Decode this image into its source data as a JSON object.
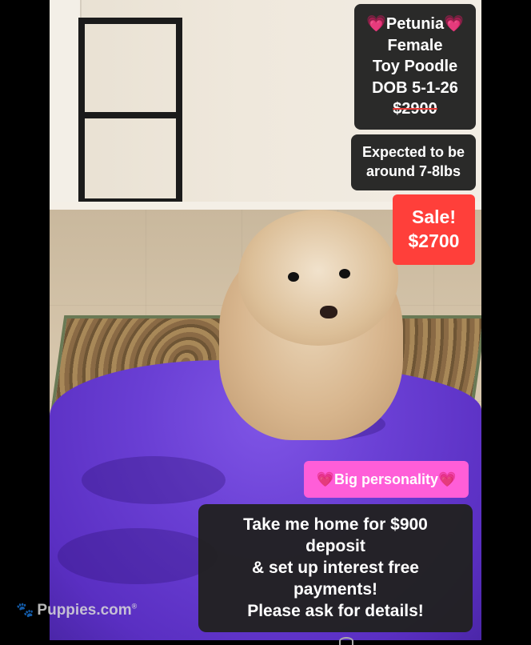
{
  "photo": {
    "subject": "Toy Poodle puppy lying on purple blanket"
  },
  "overlays": {
    "name_line": "Petunia",
    "sex": "Female",
    "breed": "Toy Poodle",
    "dob": "DOB 5-1-26",
    "old_price": "$2900",
    "weight_line1": "Expected to be",
    "weight_line2": "around 7-8lbs",
    "sale_line1": "Sale!",
    "sale_line2": "$2700",
    "personality": "Big personality",
    "deposit_line1": "Take me home for $900",
    "deposit_line2": "deposit",
    "deposit_line3": "& set up interest free",
    "deposit_line4": "payments!",
    "deposit_line5": "Please ask for details!"
  },
  "watermark": {
    "text": "Puppies.com",
    "mark": "®"
  },
  "colors": {
    "overlay_dark": "#212121",
    "sale_red": "#ff3f3a",
    "personality_pink": "#ff5ed8",
    "blanket_purple": "#6a3fd4",
    "heart_pink": "#ff7fb0"
  },
  "icons": [
    "heart-icon",
    "paw-icon"
  ]
}
